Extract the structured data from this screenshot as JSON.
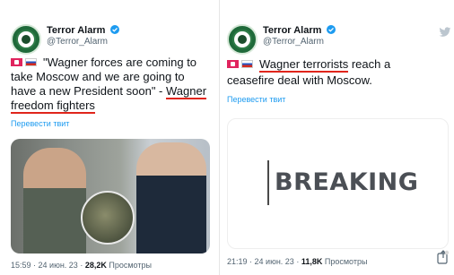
{
  "left_tweet": {
    "author_name": "Terror Alarm",
    "author_handle": "@Terror_Alarm",
    "text_line1": "\"Wagner forces are coming to",
    "text_line2": "take Moscow and we are going to",
    "text_line3_pre": "have a new President soon\" - ",
    "text_line3_ul": "Wagner",
    "text_line4_ul": "freedom fighters",
    "translate_link": "Перевести твит",
    "time": "15:59",
    "date": "24 июн. 23",
    "views_count": "28,2K",
    "views_label": "Просмотры"
  },
  "right_tweet": {
    "author_name": "Terror Alarm",
    "author_handle": "@Terror_Alarm",
    "text_line1_ul": "Wagner terrorists",
    "text_line1_post": " reach a",
    "text_line2": "ceasefire deal with Moscow.",
    "translate_link": "Перевести твит",
    "card_text": "BREAKING",
    "time": "21:19",
    "date": "24 июн. 23",
    "views_count": "11,8K",
    "views_label": "Просмотры"
  },
  "icons": [
    "verified-badge-icon",
    "twitter-bird-icon",
    "share-icon"
  ],
  "colors": {
    "link": "#1d9bf0",
    "underline": "#e0251b",
    "verified": "#1d9bf0"
  }
}
